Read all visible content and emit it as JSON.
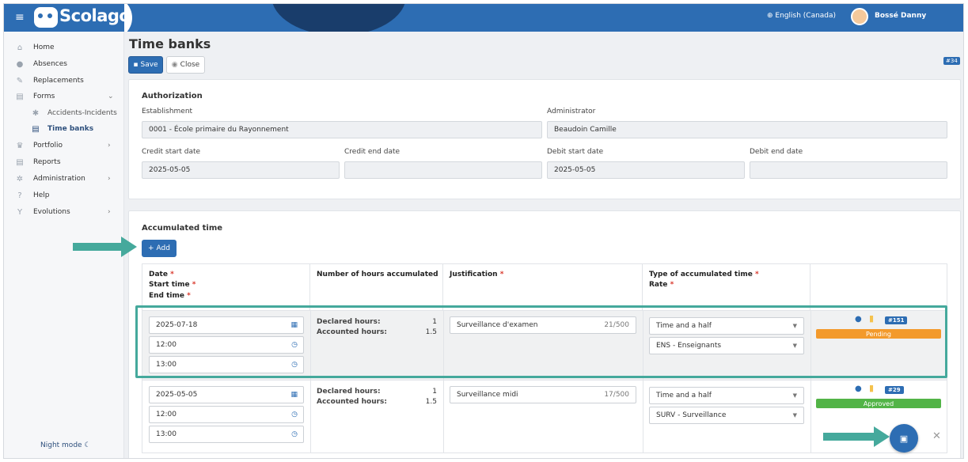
{
  "header": {
    "brand": "Scolago",
    "language": "English (Canada)",
    "user": "Bossé Danny"
  },
  "sidebar": {
    "items": [
      {
        "label": "Home",
        "icon": "home-icon"
      },
      {
        "label": "Absences",
        "icon": "absence-icon"
      },
      {
        "label": "Replacements",
        "icon": "replacement-icon"
      },
      {
        "label": "Forms",
        "icon": "forms-icon"
      },
      {
        "label": "Accidents-Incidents",
        "icon": "accident-icon"
      },
      {
        "label": "Time banks",
        "icon": "timebank-icon"
      },
      {
        "label": "Portfolio",
        "icon": "trophy-icon"
      },
      {
        "label": "Reports",
        "icon": "report-icon"
      },
      {
        "label": "Administration",
        "icon": "gear-icon"
      },
      {
        "label": "Help",
        "icon": "help-icon"
      },
      {
        "label": "Evolutions",
        "icon": "sprout-icon"
      }
    ],
    "night_mode": "Night mode"
  },
  "page": {
    "title": "Time banks",
    "save": "Save",
    "close": "Close",
    "id_badge": "#34"
  },
  "authorization": {
    "title": "Authorization",
    "establishment_label": "Establishment",
    "establishment": "0001 - École primaire du Rayonnement",
    "administrator_label": "Administrator",
    "administrator": "Beaudoin Camille",
    "credit_start_label": "Credit start date",
    "credit_start": "2025-05-05",
    "credit_end_label": "Credit end date",
    "credit_end": "",
    "debit_start_label": "Debit start date",
    "debit_start": "2025-05-05",
    "debit_end_label": "Debit end date",
    "debit_end": ""
  },
  "accumulated": {
    "title": "Accumulated time",
    "add": "Add",
    "headers": {
      "date": "Date",
      "start": "Start time",
      "end": "End time",
      "hours": "Number of hours accumulated",
      "justification": "Justification",
      "type": "Type of accumulated time",
      "rate": "Rate",
      "req": "*"
    },
    "declared_label": "Declared hours:",
    "accounted_label": "Accounted hours:",
    "rows": [
      {
        "date": "2025-07-18",
        "start": "12:00",
        "end": "13:00",
        "declared": "1",
        "accounted": "1.5",
        "justification": "Surveillance d'examen",
        "count": "21/500",
        "type": "Time and a half",
        "rate": "ENS - Enseignants",
        "tag": "#151",
        "status": "Pending",
        "status_color": "#f39a2c"
      },
      {
        "date": "2025-05-05",
        "start": "12:00",
        "end": "13:00",
        "declared": "1",
        "accounted": "1.5",
        "justification": "Surveillance midi",
        "count": "17/500",
        "type": "Time and a half",
        "rate": "SURV - Surveillance",
        "tag": "#29",
        "status": "Approved",
        "status_color": "#52b447"
      }
    ]
  }
}
